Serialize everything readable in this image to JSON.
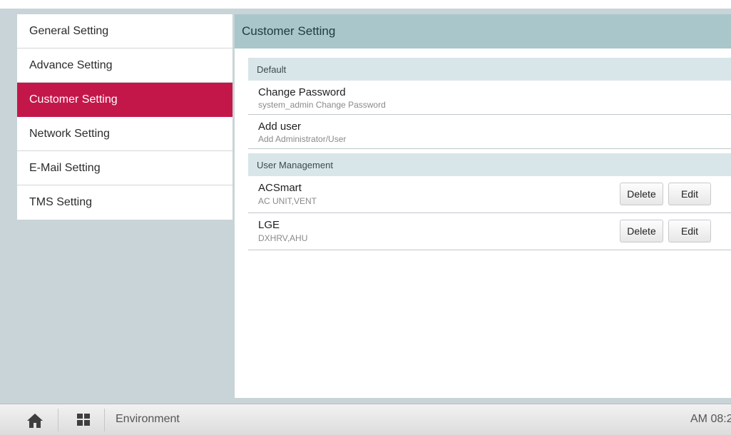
{
  "sidebar": {
    "items": [
      {
        "label": "General Setting"
      },
      {
        "label": "Advance Setting"
      },
      {
        "label": "Customer Setting"
      },
      {
        "label": "Network Setting"
      },
      {
        "label": "E-Mail Setting"
      },
      {
        "label": "TMS Setting"
      }
    ],
    "active_index": 2
  },
  "main": {
    "title": "Customer Setting",
    "default_section": {
      "title": "Default",
      "items": [
        {
          "title": "Change Password",
          "subtitle": "system_admin Change Password"
        },
        {
          "title": "Add user",
          "subtitle": "Add Administrator/User"
        }
      ]
    },
    "user_management": {
      "title": "User Management",
      "users": [
        {
          "name": "ACSmart",
          "types": "AC UNIT,VENT"
        },
        {
          "name": "LGE",
          "types": "DXHRV,AHU"
        }
      ],
      "delete_label": "Delete",
      "edit_label": "Edit"
    }
  },
  "bottom_bar": {
    "section_label": "Environment",
    "time": "AM 08:2"
  },
  "colors": {
    "active": "#c3174a",
    "header": "#a9c6cb",
    "section": "#d8e6e9"
  },
  "icons": {
    "home": "home-icon",
    "menu": "grid-icon"
  }
}
